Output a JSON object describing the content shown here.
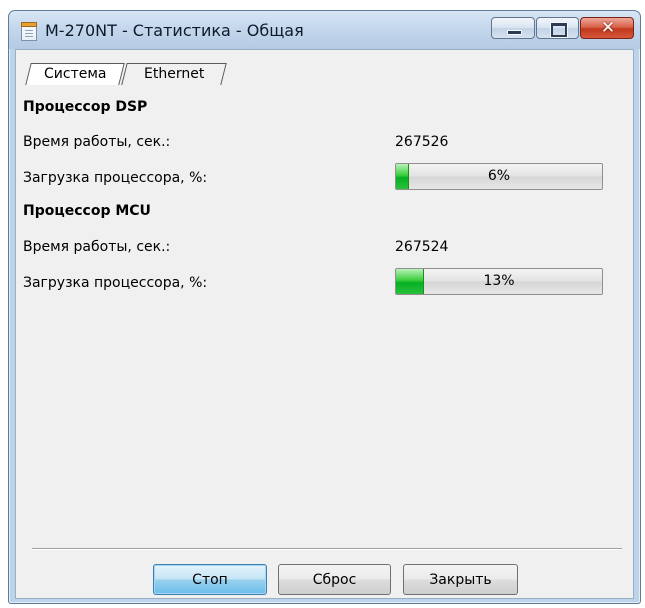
{
  "window": {
    "title": "M-270NT - Статистика - Общая",
    "icon": "document-icon"
  },
  "tabs": [
    {
      "label": "Система",
      "active": true
    },
    {
      "label": "Ethernet",
      "active": false
    }
  ],
  "dsp": {
    "title": "Процессор DSP",
    "uptime_label": "Время работы, сек.:",
    "uptime_value": "267526",
    "load_label": "Загрузка процессора, %:",
    "load_percent": 6,
    "load_text": "6%"
  },
  "mcu": {
    "title": "Процессор MCU",
    "uptime_label": "Время работы, сек.:",
    "uptime_value": "267524",
    "load_label": "Загрузка процессора, %:",
    "load_percent": 13,
    "load_text": "13%"
  },
  "buttons": {
    "stop": "Стоп",
    "reset": "Сброс",
    "close": "Закрыть"
  },
  "colors": {
    "progress_fill": "#06b025",
    "close_button": "#c1391e",
    "default_button_border": "#3c7fb1"
  }
}
